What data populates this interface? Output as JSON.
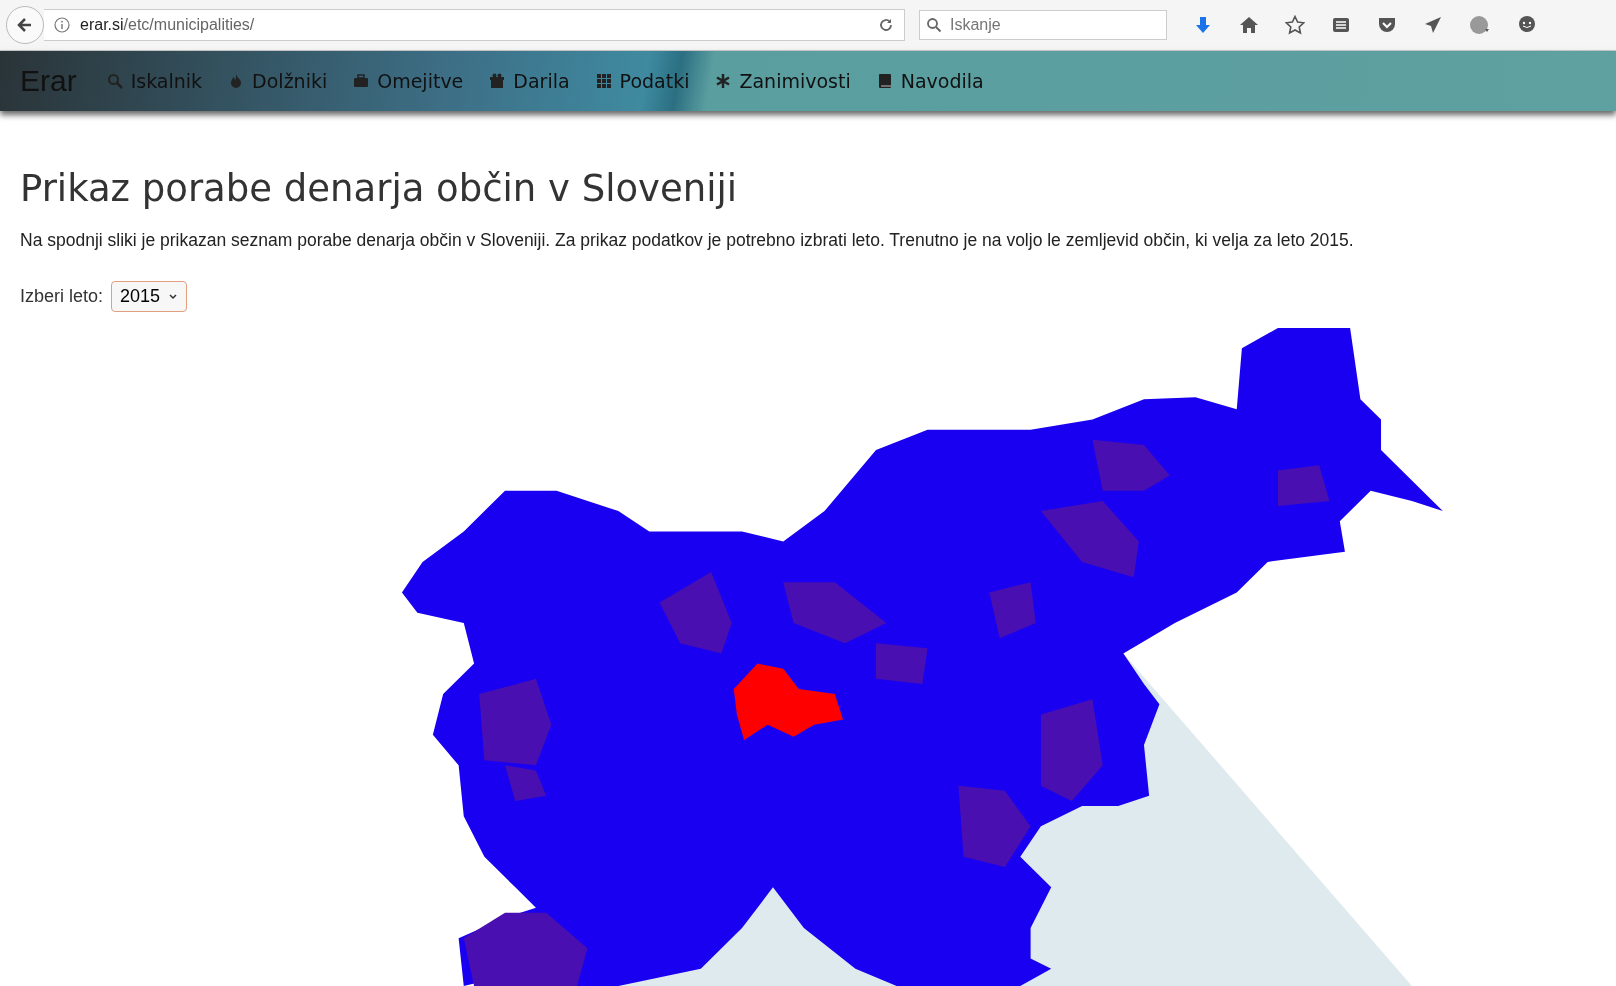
{
  "browser": {
    "url_host": "erar.si",
    "url_path": "/etc/municipalities/",
    "search_placeholder": "Iskanje"
  },
  "nav": {
    "brand": "Erar",
    "items": [
      {
        "label": "Iskalnik"
      },
      {
        "label": "Dolžniki"
      },
      {
        "label": "Omejitve"
      },
      {
        "label": "Darila"
      },
      {
        "label": "Podatki"
      },
      {
        "label": "Zanimivosti"
      },
      {
        "label": "Navodila"
      }
    ]
  },
  "heading": "Prikaz porabe denarja občin v Sloveniji",
  "intro": "Na spodnji sliki je prikazan seznam porabe denarja občin v Sloveniji. Za prikaz podatkov je potrebno izbrati leto. Trenutno je na voljo le zemljevid občin, ki velja za leto 2015.",
  "year_picker": {
    "label": "Izberi leto:",
    "value": "2015"
  }
}
